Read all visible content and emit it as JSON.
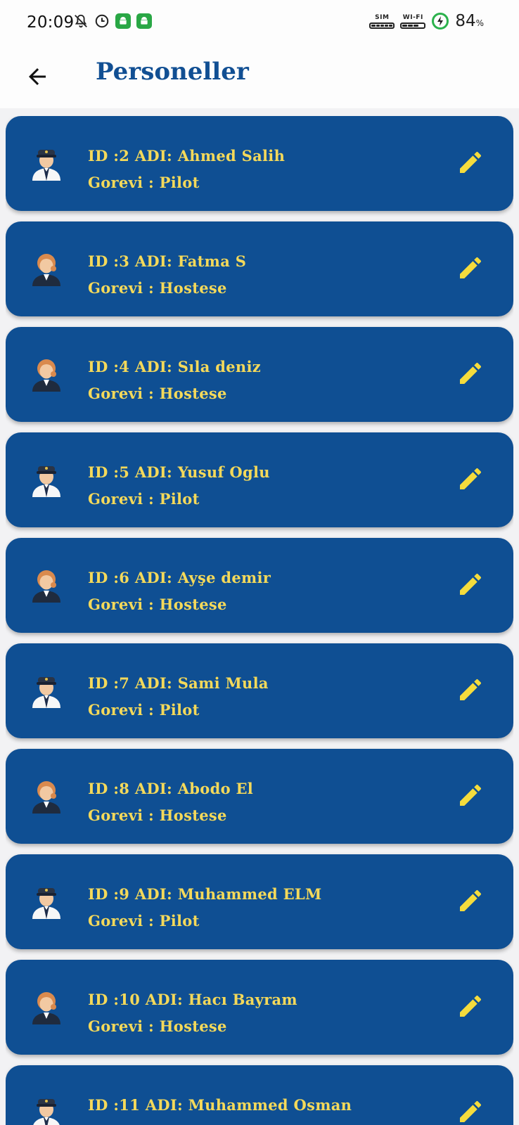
{
  "status_bar": {
    "time": "20:09",
    "sim_label": "SIM",
    "wifi_label": "WI-FI",
    "battery_value": "84",
    "battery_unit": "%",
    "icons": [
      "bell-off-icon",
      "alarm-icon",
      "android-icon",
      "android-icon",
      "sim-signal-icon",
      "wifi-signal-icon",
      "battery-charging-icon"
    ]
  },
  "app_bar": {
    "title": "Personeller",
    "back_icon": "arrow-left-icon"
  },
  "colors": {
    "primary": "#0f4f93",
    "accent_text": "#f4d95a",
    "title": "#114f93",
    "background": "#f2f2f4"
  },
  "staff": [
    {
      "id_line": "ID :2 ADI: Ahmed Salih",
      "role_line": "Gorevi : Pilot",
      "avatar": "pilot-avatar-icon"
    },
    {
      "id_line": "ID :3 ADI: Fatma S",
      "role_line": "Gorevi : Hostese",
      "avatar": "stewardess-avatar-icon"
    },
    {
      "id_line": "ID :4 ADI: Sıla deniz",
      "role_line": "Gorevi : Hostese",
      "avatar": "stewardess-avatar-icon"
    },
    {
      "id_line": "ID :5 ADI: Yusuf Oglu",
      "role_line": "Gorevi : Pilot",
      "avatar": "pilot-avatar-icon"
    },
    {
      "id_line": "ID :6 ADI: Ayşe demir",
      "role_line": "Gorevi : Hostese",
      "avatar": "stewardess-avatar-icon"
    },
    {
      "id_line": "ID :7 ADI: Sami Mula",
      "role_line": "Gorevi : Pilot",
      "avatar": "pilot-avatar-icon"
    },
    {
      "id_line": "ID :8 ADI: Abodo El",
      "role_line": "Gorevi : Hostese",
      "avatar": "stewardess-avatar-icon"
    },
    {
      "id_line": "ID :9 ADI: Muhammed ELM",
      "role_line": "Gorevi : Pilot",
      "avatar": "pilot-avatar-icon"
    },
    {
      "id_line": "ID :10 ADI: Hacı Bayram",
      "role_line": "Gorevi : Hostese",
      "avatar": "stewardess-avatar-icon"
    },
    {
      "id_line": "ID :11 ADI: Muhammed Osman",
      "role_line": "",
      "avatar": "pilot-avatar-icon"
    }
  ]
}
